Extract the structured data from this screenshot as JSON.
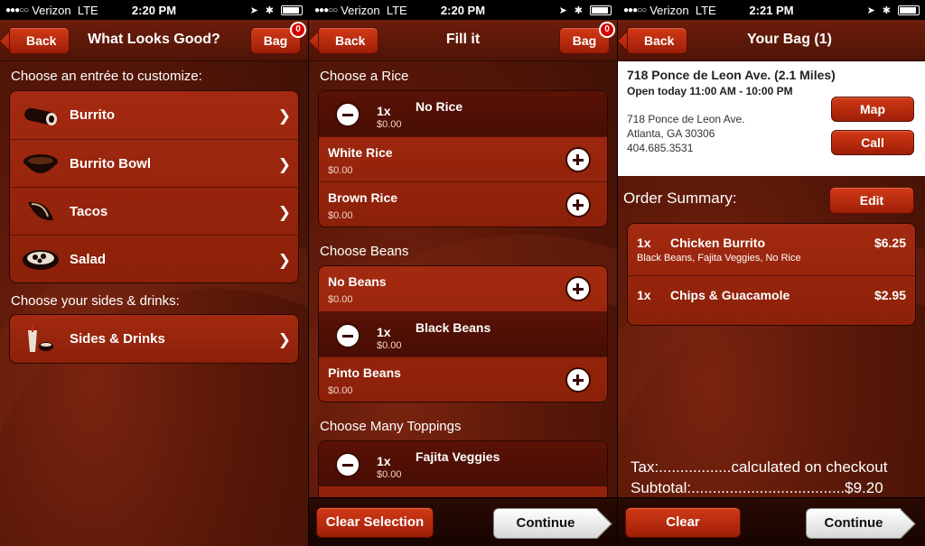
{
  "status": {
    "screen1": {
      "signal": "●●●○○",
      "carrier": "Verizon",
      "network": "LTE",
      "time": "2:20 PM"
    },
    "screen2": {
      "signal": "●●●○○",
      "carrier": "Verizon",
      "network": "LTE",
      "time": "2:20 PM"
    },
    "screen3": {
      "signal": "●●●○○",
      "carrier": "Verizon",
      "network": "LTE",
      "time": "2:21 PM"
    },
    "location_icon": "➤",
    "bluetooth_icon": "✱"
  },
  "screen1": {
    "back_label": "Back",
    "title": "What Looks Good?",
    "bag_label": "Bag",
    "bag_count": "0",
    "entree_section": "Choose an entrée to customize:",
    "entrees": [
      {
        "label": "Burrito",
        "icon": "burrito-icon"
      },
      {
        "label": "Burrito Bowl",
        "icon": "bowl-icon"
      },
      {
        "label": "Tacos",
        "icon": "taco-icon"
      },
      {
        "label": "Salad",
        "icon": "salad-icon"
      }
    ],
    "sides_section": "Choose your sides & drinks:",
    "sides": [
      {
        "label": "Sides & Drinks",
        "icon": "drink-icon"
      }
    ],
    "chevron": "❯"
  },
  "screen2": {
    "back_label": "Back",
    "title": "Fill it",
    "bag_label": "Bag",
    "bag_count": "0",
    "rice_section": "Choose a Rice",
    "rice": [
      {
        "name": "No Rice",
        "qty": "1x",
        "price": "$0.00",
        "selected": true
      },
      {
        "name": "White Rice",
        "price": "$0.00",
        "selected": false
      },
      {
        "name": "Brown Rice",
        "price": "$0.00",
        "selected": false
      }
    ],
    "beans_section": "Choose Beans",
    "beans": [
      {
        "name": "No Beans",
        "price": "$0.00",
        "selected": false
      },
      {
        "name": "Black Beans",
        "qty": "1x",
        "price": "$0.00",
        "selected": true
      },
      {
        "name": "Pinto Beans",
        "price": "$0.00",
        "selected": false
      }
    ],
    "toppings_section": "Choose Many Toppings",
    "toppings": [
      {
        "name": "Fajita Veggies",
        "qty": "1x",
        "price": "$0.00",
        "selected": true
      }
    ],
    "clear_label": "Clear Selection",
    "continue_label": "Continue"
  },
  "screen3": {
    "back_label": "Back",
    "title": "Your Bag (1)",
    "store_name": "718 Ponce de Leon Ave. (2.1 Miles)",
    "hours": "Open today 11:00 AM - 10:00 PM",
    "address1": "718 Ponce de Leon Ave.",
    "address2": "Atlanta, GA 30306",
    "phone": "404.685.3531",
    "map_label": "Map",
    "call_label": "Call",
    "summary_label": "Order Summary:",
    "edit_label": "Edit",
    "items": [
      {
        "qty": "1x",
        "name": "Chicken Burrito",
        "price": "$6.25",
        "details": "Black Beans, Fajita Veggies, No Rice"
      },
      {
        "qty": "1x",
        "name": "Chips & Guacamole",
        "price": "$2.95",
        "details": ""
      }
    ],
    "tax_line": "Tax:.................calculated on checkout",
    "subtotal_line": "Subtotal:....................................$9.20",
    "clear_label": "Clear",
    "continue_label": "Continue"
  }
}
